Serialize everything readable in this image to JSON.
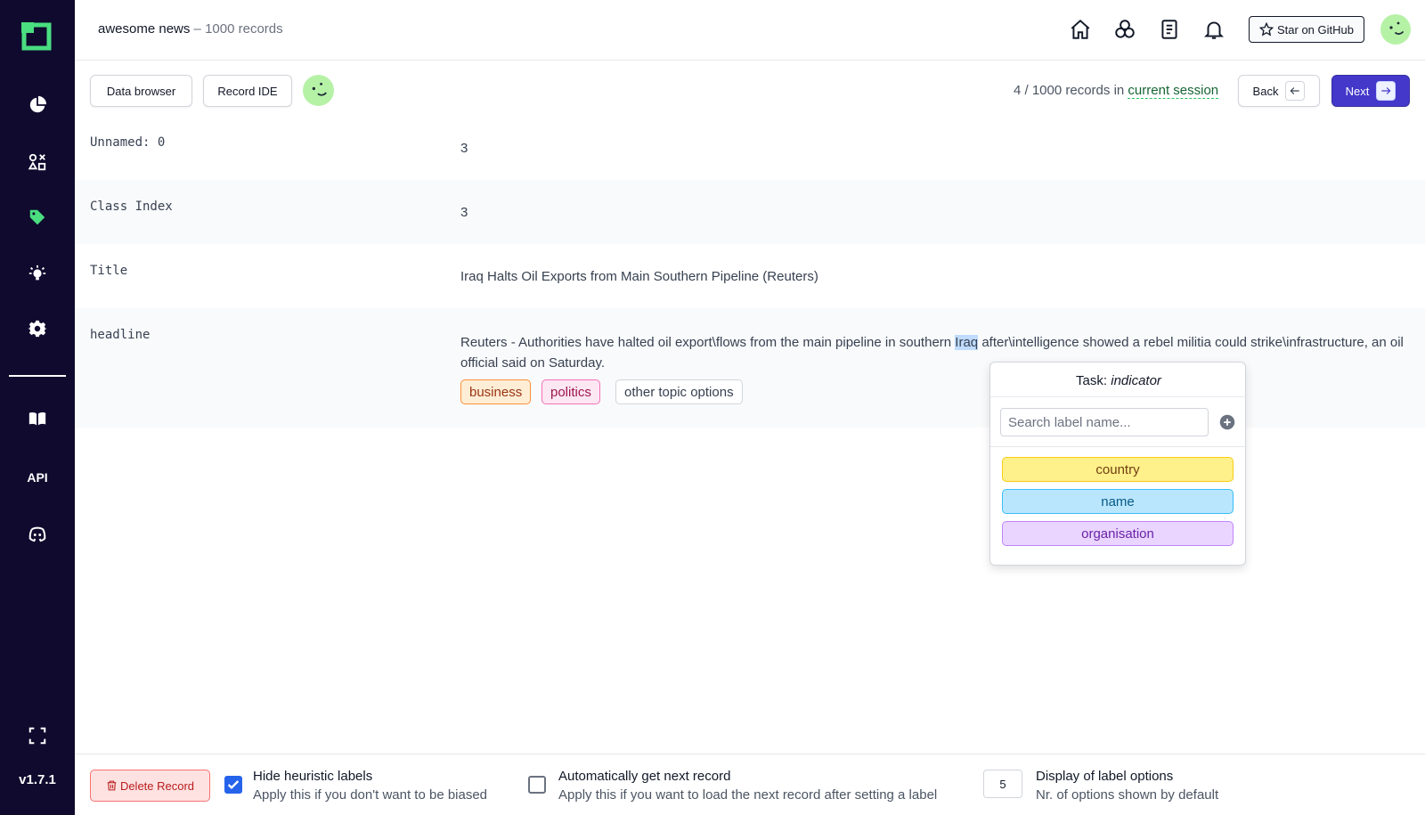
{
  "sidebar": {
    "items": [
      {
        "icon": "chart-pie-icon"
      },
      {
        "icon": "shapes-icon"
      },
      {
        "icon": "tag-icon"
      },
      {
        "icon": "bulb-icon"
      },
      {
        "icon": "gear-icon"
      },
      {
        "icon": "book-icon"
      },
      {
        "label": "API"
      },
      {
        "icon": "discord-icon"
      },
      {
        "icon": "fullscreen-icon"
      }
    ],
    "version": "v1.7.1",
    "accent": "#4ade80"
  },
  "header": {
    "project": "awesome news",
    "separator": " – ",
    "record_count": "1000 records",
    "star_label": "Star on GitHub"
  },
  "toolbar": {
    "data_browser": "Data browser",
    "record_ide": "Record IDE",
    "session_prefix": "4 / 1000 records in ",
    "session_link": "current session",
    "back_label": "Back",
    "next_label": "Next"
  },
  "record": {
    "rows": [
      {
        "key": "Unnamed: 0",
        "value": "3"
      },
      {
        "key": "Class Index",
        "value": "3"
      },
      {
        "key": "Title",
        "value": "Iraq Halts Oil Exports from Main Southern Pipeline (Reuters)"
      },
      {
        "key": "headline"
      }
    ],
    "headline_before": "Reuters - Authorities have halted oil export\\flows from the main pipeline in southern ",
    "headline_selected": "Iraq",
    "headline_after": " after\\intelligence showed a rebel militia could strike\\infrastructure, an oil official said on Saturday.",
    "labels": [
      "business",
      "politics",
      "other topic options"
    ]
  },
  "popup": {
    "task_prefix": "Task: ",
    "task_name": "indicator",
    "search_placeholder": "Search label name...",
    "options": [
      "country",
      "name",
      "organisation"
    ]
  },
  "footer": {
    "delete_label": "Delete Record",
    "hide_heuristic": {
      "title": "Hide heuristic labels",
      "desc": "Apply this if you don't want to be biased",
      "checked": true
    },
    "auto_next": {
      "title": "Automatically get next record",
      "desc": "Apply this if you want to load the next record after setting a label",
      "checked": false
    },
    "display_options": {
      "value": "5",
      "title": "Display of label options",
      "desc": "Nr. of options shown by default"
    }
  }
}
